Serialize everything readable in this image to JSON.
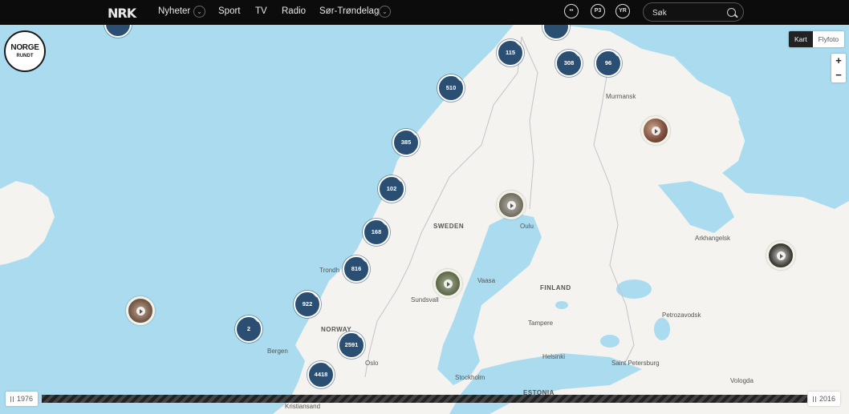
{
  "header": {
    "logo": "NRK",
    "nav": [
      {
        "label": "Nyheter",
        "has_dropdown": true
      },
      {
        "label": "Sport",
        "has_dropdown": false
      },
      {
        "label": "TV",
        "has_dropdown": false
      },
      {
        "label": "Radio",
        "has_dropdown": false
      },
      {
        "label": "Sør-Trøndelag",
        "has_dropdown": true
      }
    ],
    "icons": [
      {
        "name": "nrk-super-icon",
        "glyph": "••"
      },
      {
        "name": "nrk-p3-icon",
        "glyph": "P3"
      },
      {
        "name": "nrk-yr-icon",
        "glyph": "YR"
      }
    ],
    "search": {
      "placeholder": "Søk"
    }
  },
  "map": {
    "badge": {
      "line1": "NORGE",
      "line2": "RUNDT"
    },
    "view_toggle": {
      "map": "Kart",
      "satellite": "Flyfoto",
      "selected": "Kart"
    },
    "zoom": {
      "in": "+",
      "out": "−"
    },
    "countries": [
      {
        "id": "sweden",
        "label": "SWEDEN"
      },
      {
        "id": "finland",
        "label": "FINLAND"
      },
      {
        "id": "norway",
        "label": "NORWAY"
      },
      {
        "id": "estonia",
        "label": "ESTONIA"
      }
    ],
    "cities": [
      {
        "id": "murmansk",
        "label": "Murmansk"
      },
      {
        "id": "oulu",
        "label": "Oulu"
      },
      {
        "id": "arkhangelsk",
        "label": "Arkhangelsk"
      },
      {
        "id": "trondheim",
        "label": "Trondh"
      },
      {
        "id": "vaasa",
        "label": "Vaasa"
      },
      {
        "id": "sundsvall",
        "label": "Sundsvall"
      },
      {
        "id": "tampere",
        "label": "Tampere"
      },
      {
        "id": "petrozavodsk",
        "label": "Petrozavodsk"
      },
      {
        "id": "bergen",
        "label": "Bergen"
      },
      {
        "id": "oslo",
        "label": "Oslo"
      },
      {
        "id": "helsinki",
        "label": "Helsinki"
      },
      {
        "id": "st-petersburg",
        "label": "Saint Petersburg"
      },
      {
        "id": "stockholm",
        "label": "Stockholm"
      },
      {
        "id": "vologda",
        "label": "Vologda"
      },
      {
        "id": "kristiansand",
        "label": "Kristiansand"
      }
    ],
    "clusters": [
      {
        "id": "c-top-left",
        "count": ""
      },
      {
        "id": "c-top-mid",
        "count": ""
      },
      {
        "id": "c-115",
        "count": "115"
      },
      {
        "id": "c-308",
        "count": "308"
      },
      {
        "id": "c-96",
        "count": "96"
      },
      {
        "id": "c-510",
        "count": "510"
      },
      {
        "id": "c-385",
        "count": "385"
      },
      {
        "id": "c-102",
        "count": "102"
      },
      {
        "id": "c-168",
        "count": "168"
      },
      {
        "id": "c-816",
        "count": "816"
      },
      {
        "id": "c-922",
        "count": "922"
      },
      {
        "id": "c-2",
        "count": "2"
      },
      {
        "id": "c-2591",
        "count": "2591"
      },
      {
        "id": "c-4418",
        "count": "4418"
      }
    ],
    "photos": [
      "kola",
      "north-sweden",
      "sundsvall",
      "arkhangelsk",
      "faroe"
    ]
  },
  "timeline": {
    "start": "1976",
    "end": "2016"
  }
}
